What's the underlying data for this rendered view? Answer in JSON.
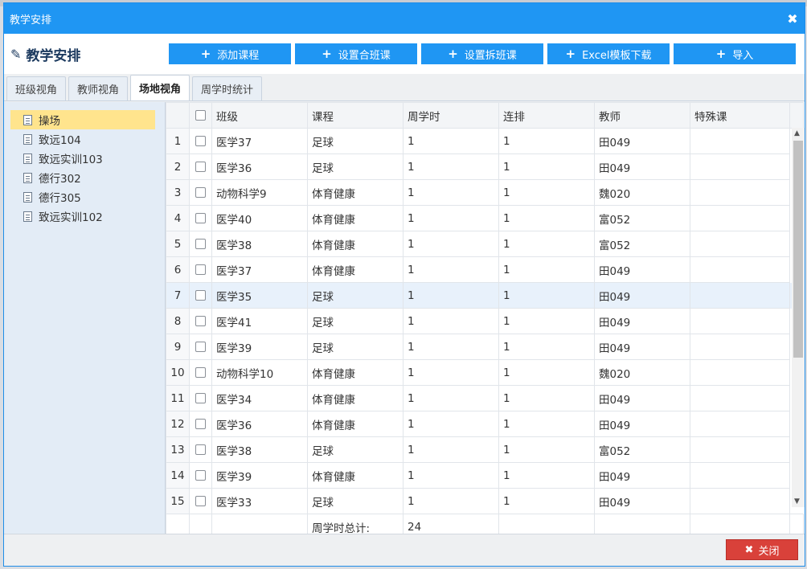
{
  "window": {
    "title": "教学安排",
    "close_glyph": "✖"
  },
  "header": {
    "title": "教学安排"
  },
  "toolbar": [
    {
      "label": "添加课程"
    },
    {
      "label": "设置合班课"
    },
    {
      "label": "设置拆班课"
    },
    {
      "label": "Excel模板下载"
    },
    {
      "label": "导入"
    }
  ],
  "tabs": [
    "班级视角",
    "教师视角",
    "场地视角",
    "周学时统计"
  ],
  "active_tab": "场地视角",
  "tree": [
    {
      "label": "操场",
      "selected": true
    },
    {
      "label": "致远104"
    },
    {
      "label": "致远实训103"
    },
    {
      "label": "德行302"
    },
    {
      "label": "德行305"
    },
    {
      "label": "致远实训102"
    }
  ],
  "table": {
    "columns": [
      "班级",
      "课程",
      "周学时",
      "连排",
      "教师",
      "特殊课"
    ],
    "rows": [
      {
        "n": "1",
        "class": "医学37",
        "course": "足球",
        "hours": "1",
        "consec": "1",
        "teacher": "田049",
        "special": ""
      },
      {
        "n": "2",
        "class": "医学36",
        "course": "足球",
        "hours": "1",
        "consec": "1",
        "teacher": "田049",
        "special": ""
      },
      {
        "n": "3",
        "class": "动物科学9",
        "course": "体育健康",
        "hours": "1",
        "consec": "1",
        "teacher": "魏020",
        "special": ""
      },
      {
        "n": "4",
        "class": "医学40",
        "course": "体育健康",
        "hours": "1",
        "consec": "1",
        "teacher": "富052",
        "special": ""
      },
      {
        "n": "5",
        "class": "医学38",
        "course": "体育健康",
        "hours": "1",
        "consec": "1",
        "teacher": "富052",
        "special": ""
      },
      {
        "n": "6",
        "class": "医学37",
        "course": "体育健康",
        "hours": "1",
        "consec": "1",
        "teacher": "田049",
        "special": ""
      },
      {
        "n": "7",
        "class": "医学35",
        "course": "足球",
        "hours": "1",
        "consec": "1",
        "teacher": "田049",
        "special": ""
      },
      {
        "n": "8",
        "class": "医学41",
        "course": "足球",
        "hours": "1",
        "consec": "1",
        "teacher": "田049",
        "special": ""
      },
      {
        "n": "9",
        "class": "医学39",
        "course": "足球",
        "hours": "1",
        "consec": "1",
        "teacher": "田049",
        "special": ""
      },
      {
        "n": "10",
        "class": "动物科学10",
        "course": "体育健康",
        "hours": "1",
        "consec": "1",
        "teacher": "魏020",
        "special": ""
      },
      {
        "n": "11",
        "class": "医学34",
        "course": "体育健康",
        "hours": "1",
        "consec": "1",
        "teacher": "田049",
        "special": ""
      },
      {
        "n": "12",
        "class": "医学36",
        "course": "体育健康",
        "hours": "1",
        "consec": "1",
        "teacher": "田049",
        "special": ""
      },
      {
        "n": "13",
        "class": "医学38",
        "course": "足球",
        "hours": "1",
        "consec": "1",
        "teacher": "富052",
        "special": ""
      },
      {
        "n": "14",
        "class": "医学39",
        "course": "体育健康",
        "hours": "1",
        "consec": "1",
        "teacher": "田049",
        "special": ""
      },
      {
        "n": "15",
        "class": "医学33",
        "course": "足球",
        "hours": "1",
        "consec": "1",
        "teacher": "田049",
        "special": ""
      }
    ],
    "highlight_row": "7",
    "footer": {
      "label": "周学时总计:",
      "value": "24"
    }
  },
  "footer_bar": {
    "close_label": "关闭"
  },
  "colors": {
    "primary": "#1f96f3",
    "danger": "#d9413a",
    "selected": "#ffe48d"
  }
}
